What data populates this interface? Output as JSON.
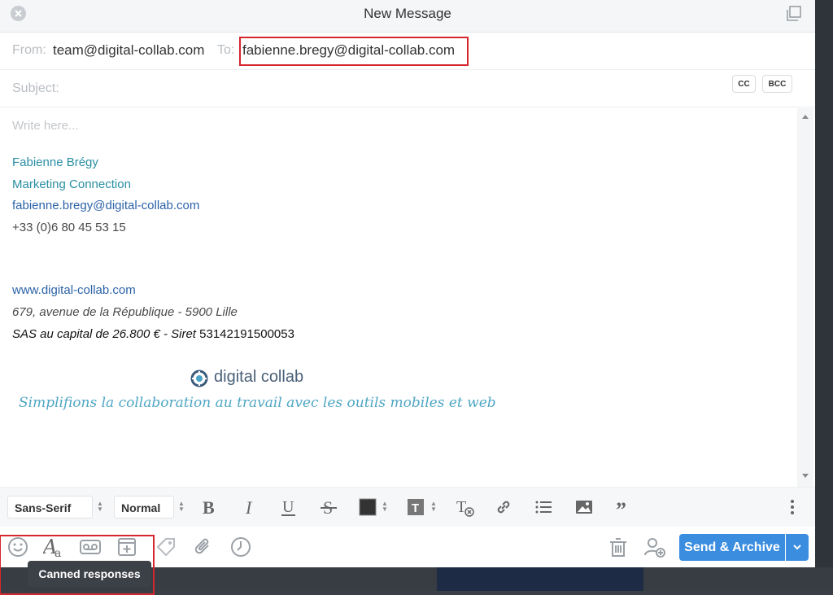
{
  "window": {
    "title": "New Message"
  },
  "header": {
    "from_label": "From:",
    "from_value": "team@digital-collab.com",
    "to_label": "To:",
    "to_value": "fabienne.bregy@digital-collab.com",
    "cc_label": "CC",
    "bcc_label": "BCC",
    "subject_label": "Subject:"
  },
  "body": {
    "placeholder": "Write here...",
    "signature": {
      "name": "Fabienne Brégy",
      "title": "Marketing Connection",
      "email": "fabienne.bregy@digital-collab.com",
      "phone": "+33 (0)6 80 45 53 15",
      "website": "www.digital-collab.com",
      "address": "679, avenue de la République - 5900 Lille",
      "legal_italic": "SAS au capital de 26.800 € - Siret",
      "siret": "53142191500053"
    },
    "logo": {
      "brand": "digital collab",
      "tagline": "Simplifions la collaboration au travail avec les outils mobiles et web"
    }
  },
  "toolbar": {
    "font_family": "Sans-Serif",
    "font_size": "Normal",
    "icons": [
      "bold-icon",
      "italic-icon",
      "underline-icon",
      "strikethrough-icon",
      "text-color-icon",
      "highlight-icon",
      "clear-format-icon",
      "link-icon",
      "list-icon",
      "image-icon",
      "quote-icon",
      "more-icon"
    ]
  },
  "actions": {
    "send_label": "Send & Archive",
    "tooltip": "Canned responses"
  },
  "colors": {
    "accent": "#3b8de0",
    "highlight_box": "#d6262e",
    "signature_teal": "#2a8fa3",
    "link_blue": "#2d63a8"
  }
}
